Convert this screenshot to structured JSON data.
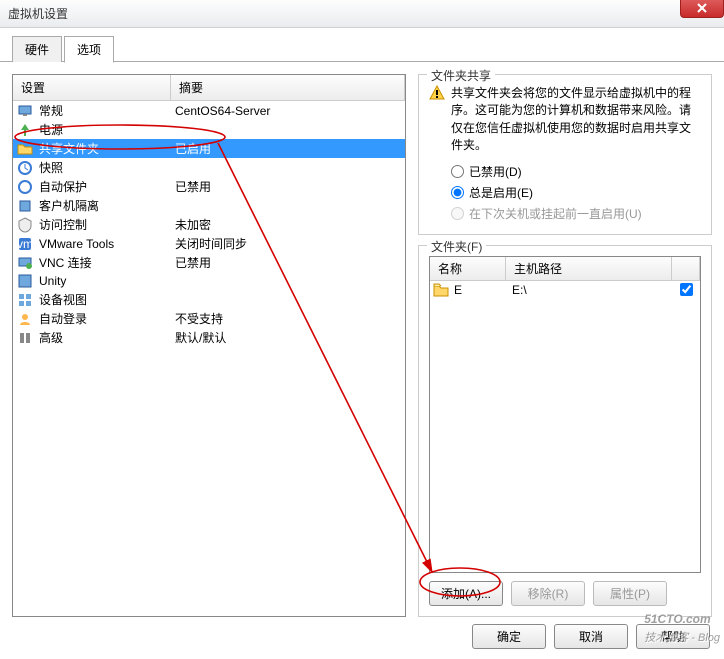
{
  "window": {
    "title": "虚拟机设置"
  },
  "tabs": {
    "hardware": "硬件",
    "options": "选项"
  },
  "leftHeader": {
    "setting": "设置",
    "summary": "摘要"
  },
  "rows": [
    {
      "icon": "monitor",
      "name": "常规",
      "summary": "CentOS64-Server"
    },
    {
      "icon": "power",
      "name": "电源",
      "summary": ""
    },
    {
      "icon": "folder-share",
      "name": "共享文件夹",
      "summary": "已启用",
      "selected": true
    },
    {
      "icon": "snapshot",
      "name": "快照",
      "summary": ""
    },
    {
      "icon": "autoprotect",
      "name": "自动保护",
      "summary": "已禁用"
    },
    {
      "icon": "isolation",
      "name": "客户机隔离",
      "summary": ""
    },
    {
      "icon": "access",
      "name": "访问控制",
      "summary": "未加密"
    },
    {
      "icon": "vmtools",
      "name": "VMware Tools",
      "summary": "关闭时间同步"
    },
    {
      "icon": "vnc",
      "name": "VNC 连接",
      "summary": "已禁用"
    },
    {
      "icon": "unity",
      "name": "Unity",
      "summary": ""
    },
    {
      "icon": "appview",
      "name": "设备视图",
      "summary": ""
    },
    {
      "icon": "autologin",
      "name": "自动登录",
      "summary": "不受支持"
    },
    {
      "icon": "advanced",
      "name": "高级",
      "summary": "默认/默认"
    }
  ],
  "share": {
    "legend": "文件夹共享",
    "warning": "共享文件夹会将您的文件显示给虚拟机中的程序。这可能为您的计算机和数据带来风险。请仅在您信任虚拟机使用您的数据时启用共享文件夹。",
    "opt_disabled": "已禁用(D)",
    "opt_always": "总是启用(E)",
    "opt_next": "在下次关机或挂起前一直启用(U)"
  },
  "folders": {
    "legend": "文件夹(F)",
    "col_name": "名称",
    "col_path": "主机路径",
    "row": {
      "name": "E",
      "path": "E:\\"
    },
    "btn_add": "添加(A)...",
    "btn_remove": "移除(R)",
    "btn_props": "属性(P)"
  },
  "bottom": {
    "ok": "确定",
    "cancel": "取消",
    "help": "帮助"
  },
  "watermark": {
    "main": "51CTO.com",
    "sub": "技术博客 - Blog"
  }
}
